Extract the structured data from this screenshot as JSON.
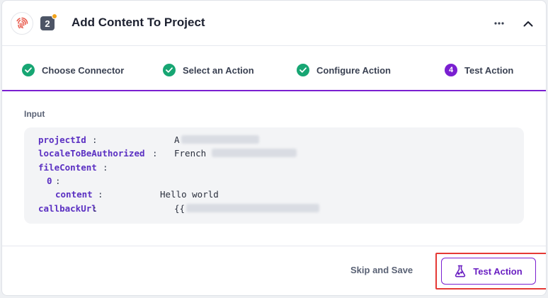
{
  "header": {
    "title": "Add Content To Project",
    "step_number": "2",
    "app_icon": "fingerprint-icon",
    "more_icon": "more-horizontal-icon",
    "collapse_icon": "chevron-up-icon"
  },
  "stepper": {
    "steps": [
      {
        "label": "Choose Connector",
        "state": "completed"
      },
      {
        "label": "Select an Action",
        "state": "completed"
      },
      {
        "label": "Configure Action",
        "state": "completed"
      },
      {
        "label": "Test Action",
        "state": "active",
        "number": "4"
      }
    ]
  },
  "input": {
    "label": "Input",
    "rows": [
      {
        "key": "projectId",
        "value": "A"
      },
      {
        "key": "localeToBeAuthorized",
        "value": "French"
      },
      {
        "key": "fileContent",
        "value": ""
      },
      {
        "key": "0",
        "value": ""
      },
      {
        "key": "content",
        "value": "Hello world"
      },
      {
        "key": "callbackUrl",
        "value": "{{"
      }
    ]
  },
  "footer": {
    "skip_label": "Skip and Save",
    "test_label": "Test Action",
    "test_icon": "flask-icon"
  },
  "colors": {
    "accent": "#7a1fd1",
    "success": "#17a673",
    "highlight": "#e53935"
  }
}
